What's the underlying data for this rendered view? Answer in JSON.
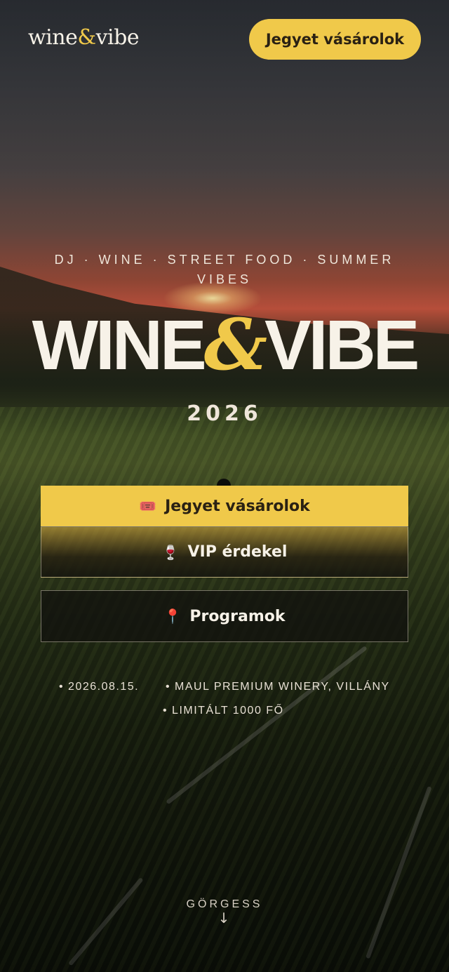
{
  "header": {
    "logo_left": "wine",
    "logo_amp": "&",
    "logo_right": "vibe",
    "cta_label": "Jegyet vásárolok"
  },
  "hero": {
    "tagline": "DJ · WINE · STREET FOOD · SUMMER VIBES",
    "title_left": "WINE",
    "title_amp": "&",
    "title_right": "VIBE",
    "year": "2026"
  },
  "actions": [
    {
      "icon": "ticket-icon",
      "glyph": "🎟️",
      "label": "Jegyet vásárolok"
    },
    {
      "icon": "wine-glass-icon",
      "glyph": "🍷",
      "label": "VIP érdekel"
    },
    {
      "icon": "pin-icon",
      "glyph": "📍",
      "label": "Programok"
    }
  ],
  "event_meta": {
    "date": "• 2026.08.15.",
    "venue": "• MAUL PREMIUM WINERY, VILLÁNY",
    "limit": "• LIMITÁLT 1000 FŐ"
  },
  "scroll": {
    "label": "GÖRGESS",
    "arrow": "↓"
  },
  "colors": {
    "accent": "#f0c94a",
    "text": "#f7f2e8",
    "dark_text": "#2a2113"
  }
}
